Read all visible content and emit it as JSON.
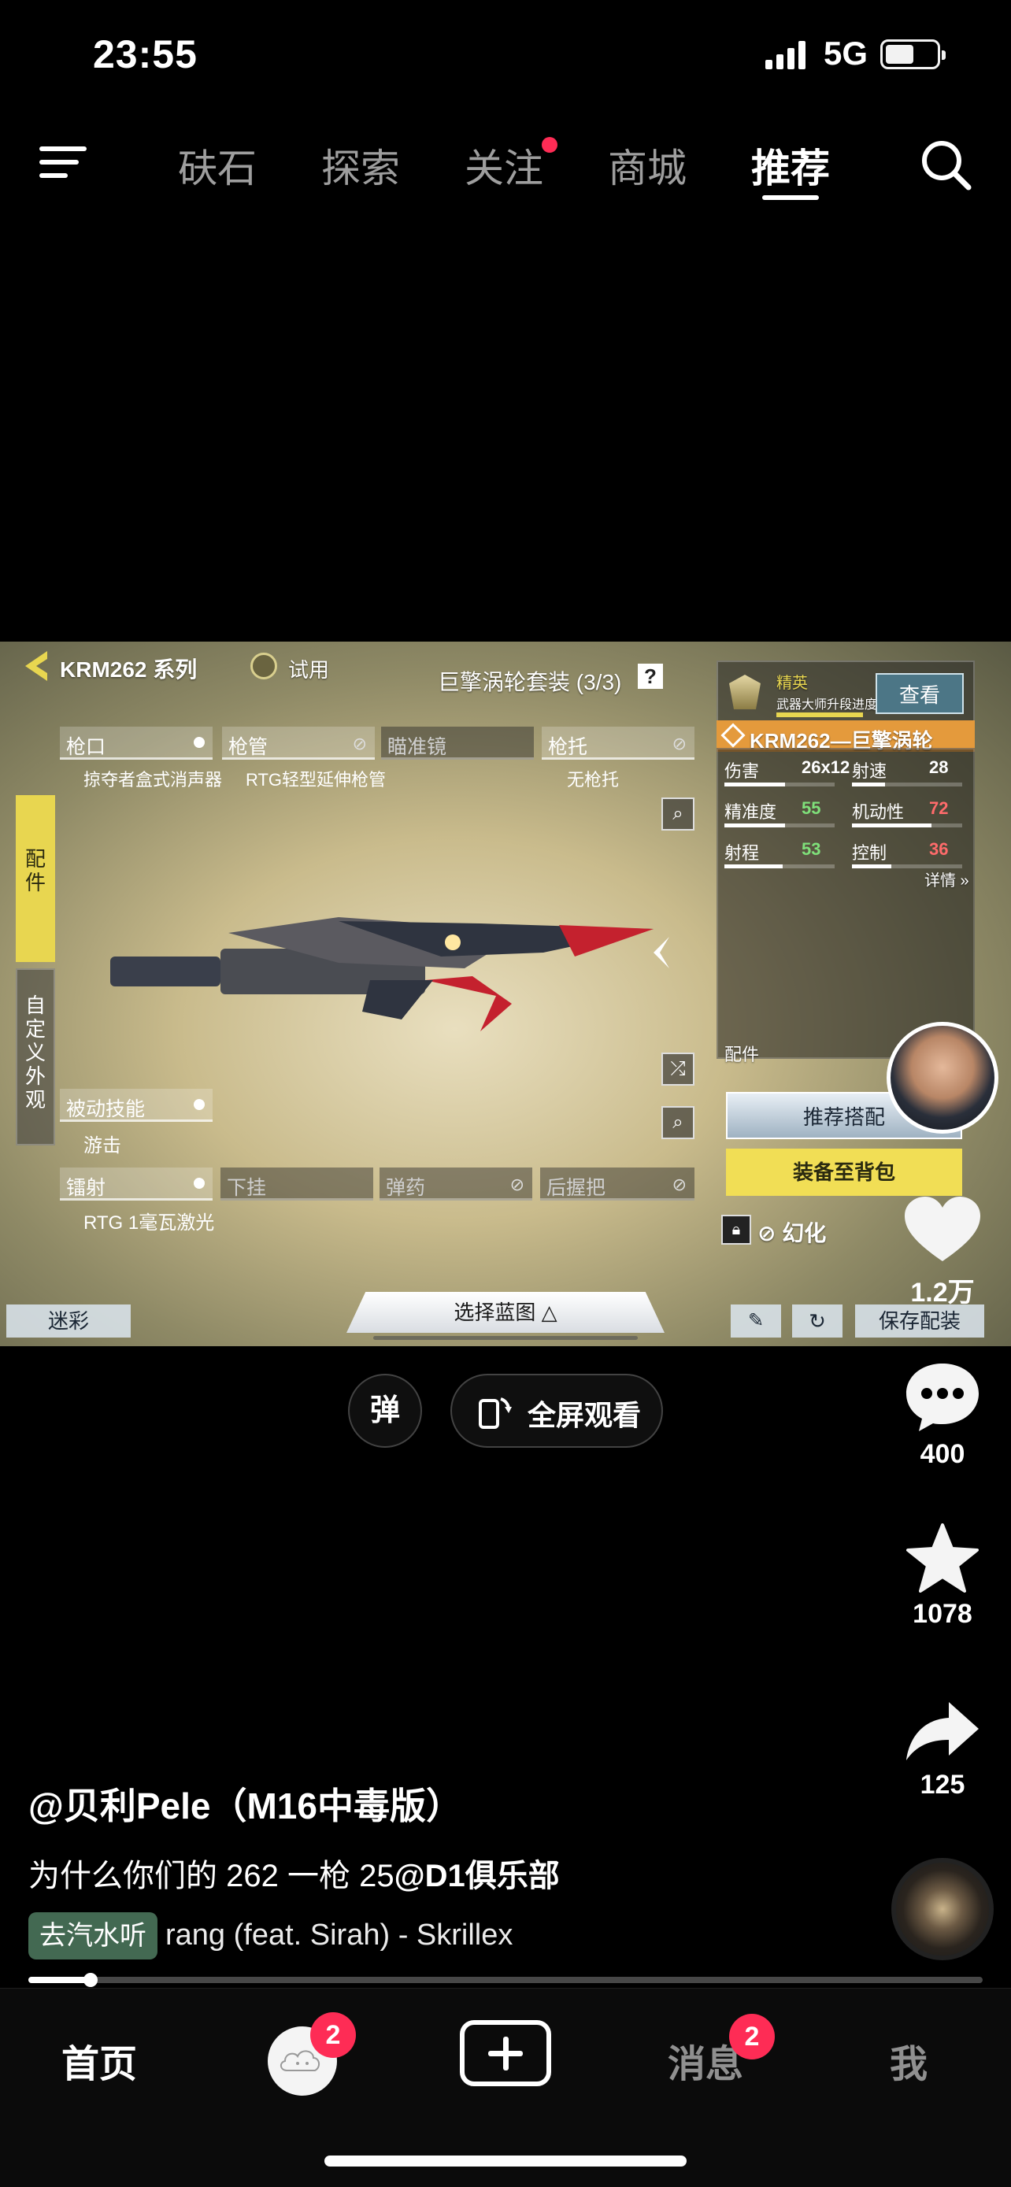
{
  "status": {
    "time": "23:55",
    "network": "5G",
    "battery_level": 0.55
  },
  "topnav": {
    "tabs": [
      {
        "label": "砆石",
        "active": false,
        "dot": false
      },
      {
        "label": "探索",
        "active": false,
        "dot": false
      },
      {
        "label": "关注",
        "active": false,
        "dot": true
      },
      {
        "label": "商城",
        "active": false,
        "dot": false
      },
      {
        "label": "推荐",
        "active": true,
        "dot": false
      }
    ]
  },
  "game": {
    "series": "KRM262 系列",
    "trial": "试用",
    "skin_set": "巨擎涡轮套装 (3/3)",
    "rank_title": "精英",
    "rank_sub": "武器大师升段进度",
    "view_btn": "查看",
    "weapon_name": "KRM262—巨擎涡轮",
    "side_tabs": [
      "配件",
      "自定义外观"
    ],
    "slots": {
      "muzzle": "枪口",
      "muzzle_item": "掠夺者盒式消声器",
      "barrel": "枪管",
      "barrel_item": "RTG轻型延伸枪管",
      "optic": "瞄准镜",
      "stock": "枪托",
      "stock_item": "无枪托",
      "perk": "被动技能",
      "perk_item": "游击",
      "laser": "镭射",
      "laser_item": "RTG 1毫瓦激光",
      "underbarrel": "下挂",
      "ammo": "弹药",
      "rear_grip": "后握把"
    },
    "stats": [
      {
        "label": "伤害",
        "value": "26x12",
        "color": "#ffffff",
        "level": 0.55
      },
      {
        "label": "射速",
        "value": "28",
        "color": "#ffffff",
        "level": 0.3
      },
      {
        "label": "精准度",
        "value": "55",
        "color": "#7fe07a",
        "level": 0.55
      },
      {
        "label": "机动性",
        "value": "72",
        "color": "#ff6b6b",
        "level": 0.72
      },
      {
        "label": "射程",
        "value": "53",
        "color": "#7fe07a",
        "level": 0.53
      },
      {
        "label": "控制",
        "value": "36",
        "color": "#ff6b6b",
        "level": 0.36
      }
    ],
    "details": "详情",
    "attachments_label": "配件",
    "recommend_btn": "推荐搭配",
    "equip_btn": "装备至背包",
    "illusion": "幻化",
    "camo": "迷彩",
    "blueprint": "选择蓝图",
    "save": "保存配装"
  },
  "actions": {
    "likes": "1.2万",
    "comments": "400",
    "favorites": "1078",
    "shares": "125"
  },
  "middle": {
    "danmu": "弹",
    "fullscreen": "全屏观看"
  },
  "post": {
    "author": "@贝利Pele（M16中毒版）",
    "description_prefix": "为什么你们的 262 一枪 25",
    "mention": "@D1俱乐部",
    "music_tag": "去汽水听",
    "music": "rang (feat. Sirah) - Skrillex"
  },
  "progress": {
    "played_fraction": 0.065
  },
  "bottombar": {
    "home": "首页",
    "friends_badge": "2",
    "messages": "消息",
    "messages_badge": "2",
    "me": "我"
  },
  "colors": {
    "accent": "#fe2c55",
    "game_yellow": "#e8d650",
    "background": "#000000"
  }
}
